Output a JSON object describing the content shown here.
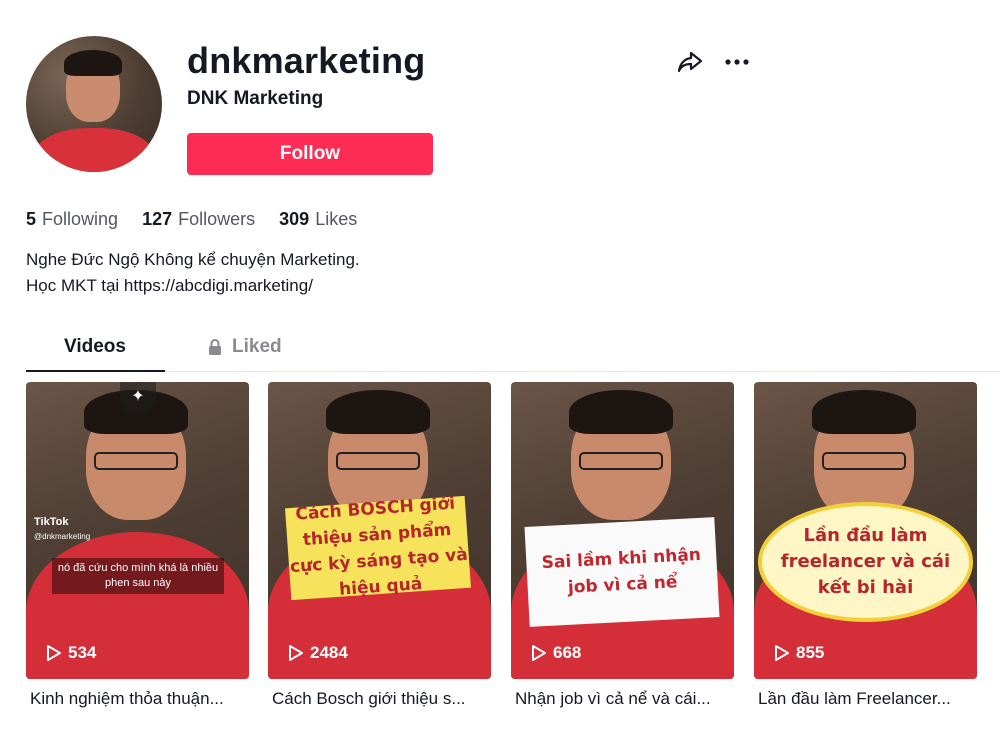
{
  "profile": {
    "username": "dnkmarketing",
    "display_name": "DNK Marketing",
    "follow_label": "Follow",
    "stats": [
      {
        "num": "5",
        "label": "Following"
      },
      {
        "num": "127",
        "label": "Followers"
      },
      {
        "num": "309",
        "label": "Likes"
      }
    ],
    "bio_line1": "Nghe Đức Ngộ Không kể chuyện Marketing.",
    "bio_line2": "Học MKT tại https://abcdigi.marketing/"
  },
  "tabs": {
    "videos": "Videos",
    "liked": "Liked"
  },
  "videos": [
    {
      "views": "534",
      "title": "Kinh nghiệm thỏa thuận...",
      "watermark": "TikTok",
      "handle": "@dnkmarketing",
      "subtitle": "nó đã cứu cho mình khá là nhiều phen sau này"
    },
    {
      "views": "2484",
      "title": "Cách Bosch giới thiệu s...",
      "overlay": "Cách BOSCH giới thiệu sản phẩm cực kỳ sáng tạo và hiệu quả"
    },
    {
      "views": "668",
      "title": "Nhận job vì cả nể và cái...",
      "overlay": "Sai lầm khi nhận job vì cả nể"
    },
    {
      "views": "855",
      "title": "Lần đầu làm Freelancer...",
      "overlay": "Lần đầu làm freelancer và cái kết bi hài"
    }
  ],
  "colors": {
    "accent": "#fe2c55",
    "text": "#161823",
    "muted": "#8a8b91"
  },
  "icons": [
    "share-icon",
    "more-icon",
    "lock-icon",
    "play-icon",
    "sparkle-icon"
  ]
}
